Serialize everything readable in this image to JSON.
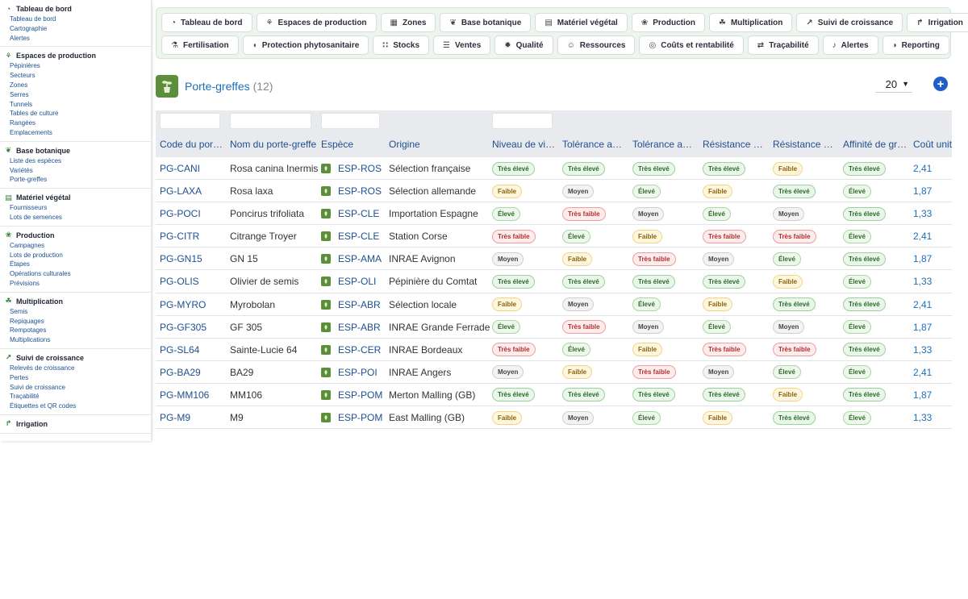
{
  "sidebar": {
    "sections": [
      {
        "title": "Tableau de bord",
        "icon": "gauge-icon",
        "items": [
          "Tableau de bord",
          "Cartographie",
          "Alertes"
        ]
      },
      {
        "title": "Espaces de production",
        "icon": "seedling-icon",
        "items": [
          "Pépinières",
          "Secteurs",
          "Zones",
          "Serres",
          "Tunnels",
          "Tables de culture",
          "Rangées",
          "Emplacements"
        ]
      },
      {
        "title": "Base botanique",
        "icon": "leaf-icon",
        "items": [
          "Liste des espèces",
          "Variétés",
          "Porte-greffes"
        ]
      },
      {
        "title": "Matériel végétal",
        "icon": "archive-icon",
        "items": [
          "Fournisseurs",
          "Lots de semences"
        ]
      },
      {
        "title": "Production",
        "icon": "sprout-icon",
        "items": [
          "Campagnes",
          "Lots de production",
          "Étapes",
          "Opérations culturales",
          "Prévisions"
        ]
      },
      {
        "title": "Multiplication",
        "icon": "hands-plant-icon",
        "items": [
          "Semis",
          "Repiquages",
          "Rempotages",
          "Multiplications"
        ]
      },
      {
        "title": "Suivi de croissance",
        "icon": "chart-line-icon",
        "items": [
          "Relevés de croissance",
          "Pertes",
          "Suivi de croissance",
          "Traçabilité",
          "Étiquettes et QR codes"
        ]
      },
      {
        "title": "Irrigation",
        "icon": "faucet-icon",
        "items": []
      }
    ]
  },
  "nav": {
    "row1": [
      {
        "label": "Tableau de bord",
        "icon": "gauge-icon"
      },
      {
        "label": "Espaces de production",
        "icon": "seedling-icon"
      },
      {
        "label": "Zones",
        "icon": "map-icon"
      },
      {
        "label": "Base botanique",
        "icon": "leaf-icon"
      },
      {
        "label": "Matériel végétal",
        "icon": "archive-icon"
      },
      {
        "label": "Production",
        "icon": "sprout-icon"
      },
      {
        "label": "Multiplication",
        "icon": "hands-plant-icon"
      },
      {
        "label": "Suivi de croissance",
        "icon": "chart-line-icon"
      },
      {
        "label": "Irrigation",
        "icon": "faucet-icon"
      }
    ],
    "row2": [
      {
        "label": "Fertilisation",
        "icon": "flask-icon"
      },
      {
        "label": "Protection phytosanitaire",
        "icon": "shield-icon"
      },
      {
        "label": "Stocks",
        "icon": "boxes-icon"
      },
      {
        "label": "Ventes",
        "icon": "receipt-icon"
      },
      {
        "label": "Qualité",
        "icon": "badge-icon"
      },
      {
        "label": "Ressources",
        "icon": "users-icon"
      },
      {
        "label": "Coûts et rentabilité",
        "icon": "coins-icon"
      },
      {
        "label": "Traçabilité",
        "icon": "route-icon"
      },
      {
        "label": "Alertes",
        "icon": "bell-icon"
      },
      {
        "label": "Reporting",
        "icon": "chart-pie-icon"
      }
    ]
  },
  "page": {
    "title": "Porte-greffes",
    "count": "(12)",
    "per_page": "20"
  },
  "table": {
    "headers": [
      "Code du port…",
      "Nom du porte-greffe",
      "Espèce",
      "Origine",
      "Niveau de vi…",
      "Tolérance au…",
      "Tolérance au…",
      "Résistance à…",
      "Résistance a…",
      "Affinité de gr…",
      "Coût unita"
    ],
    "rows": [
      {
        "code": "PG-CANI",
        "nom": "Rosa canina Inermis",
        "espece": "ESP-ROS",
        "origine": "Sélection française",
        "levels": [
          "Très élevé",
          "Très élevé",
          "Très élevé",
          "Très élevé",
          "Faible",
          "Très élevé"
        ],
        "cout": "2,41"
      },
      {
        "code": "PG-LAXA",
        "nom": "Rosa laxa",
        "espece": "ESP-ROS",
        "origine": "Sélection allemande",
        "levels": [
          "Faible",
          "Moyen",
          "Élevé",
          "Faible",
          "Très élevé",
          "Élevé"
        ],
        "cout": "1,87"
      },
      {
        "code": "PG-POCI",
        "nom": "Poncirus trifoliata",
        "espece": "ESP-CLE",
        "origine": "Importation Espagne",
        "levels": [
          "Élevé",
          "Très faible",
          "Moyen",
          "Élevé",
          "Moyen",
          "Très élevé"
        ],
        "cout": "1,33"
      },
      {
        "code": "PG-CITR",
        "nom": "Citrange Troyer",
        "espece": "ESP-CLE",
        "origine": "Station Corse",
        "levels": [
          "Très faible",
          "Élevé",
          "Faible",
          "Très faible",
          "Très faible",
          "Élevé"
        ],
        "cout": "2,41"
      },
      {
        "code": "PG-GN15",
        "nom": "GN 15",
        "espece": "ESP-AMA",
        "origine": "INRAE Avignon",
        "levels": [
          "Moyen",
          "Faible",
          "Très faible",
          "Moyen",
          "Élevé",
          "Très élevé"
        ],
        "cout": "1,87"
      },
      {
        "code": "PG-OLIS",
        "nom": "Olivier de semis",
        "espece": "ESP-OLI",
        "origine": "Pépinière du Comtat",
        "levels": [
          "Très élevé",
          "Très élevé",
          "Très élevé",
          "Très élevé",
          "Faible",
          "Élevé"
        ],
        "cout": "1,33"
      },
      {
        "code": "PG-MYRO",
        "nom": "Myrobolan",
        "espece": "ESP-ABR",
        "origine": "Sélection locale",
        "levels": [
          "Faible",
          "Moyen",
          "Élevé",
          "Faible",
          "Très élevé",
          "Très élevé"
        ],
        "cout": "2,41"
      },
      {
        "code": "PG-GF305",
        "nom": "GF 305",
        "espece": "ESP-ABR",
        "origine": "INRAE Grande Ferrade",
        "levels": [
          "Élevé",
          "Très faible",
          "Moyen",
          "Élevé",
          "Moyen",
          "Élevé"
        ],
        "cout": "1,87"
      },
      {
        "code": "PG-SL64",
        "nom": "Sainte-Lucie 64",
        "espece": "ESP-CER",
        "origine": "INRAE Bordeaux",
        "levels": [
          "Très faible",
          "Élevé",
          "Faible",
          "Très faible",
          "Très faible",
          "Très élevé"
        ],
        "cout": "1,33"
      },
      {
        "code": "PG-BA29",
        "nom": "BA29",
        "espece": "ESP-POI",
        "origine": "INRAE Angers",
        "levels": [
          "Moyen",
          "Faible",
          "Très faible",
          "Moyen",
          "Élevé",
          "Élevé"
        ],
        "cout": "2,41"
      },
      {
        "code": "PG-MM106",
        "nom": "MM106",
        "espece": "ESP-POM",
        "origine": "Merton Malling (GB)",
        "levels": [
          "Très élevé",
          "Très élevé",
          "Très élevé",
          "Très élevé",
          "Faible",
          "Très élevé"
        ],
        "cout": "1,87"
      },
      {
        "code": "PG-M9",
        "nom": "M9",
        "espece": "ESP-POM",
        "origine": "East Malling (GB)",
        "levels": [
          "Faible",
          "Moyen",
          "Élevé",
          "Faible",
          "Très élevé",
          "Élevé"
        ],
        "cout": "1,33"
      }
    ]
  },
  "colors": {
    "accent": "#1d6fb8",
    "brand_green": "#5b8f3a",
    "add_button": "#1e5ec8"
  }
}
